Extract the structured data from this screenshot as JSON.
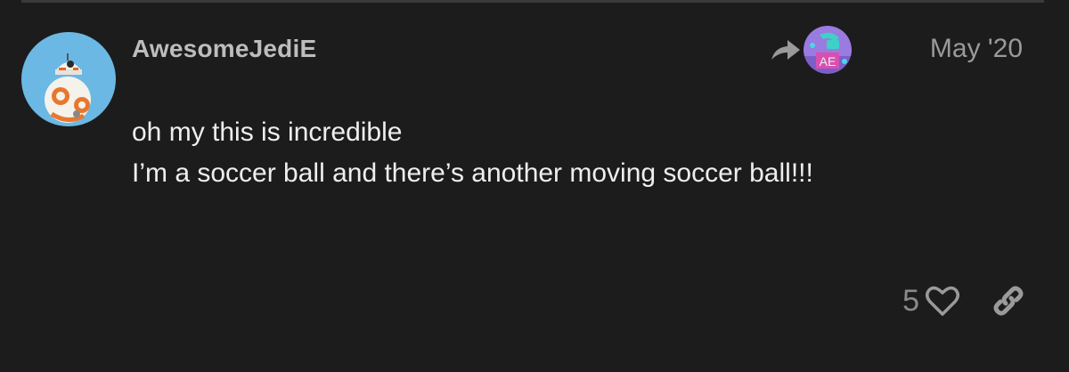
{
  "post": {
    "username": "AwesomeJediE",
    "date": "May '20",
    "lines": [
      "oh my this is incredible",
      "I’m a soccer ball and there’s another moving soccer ball!!!"
    ],
    "reply_to_avatar_text": "AE",
    "like_count": "5"
  },
  "colors": {
    "background": "#1c1c1c",
    "avatar_bg": "#6bb8e4",
    "username": "#bdbdbd",
    "meta": "#9a9a9a"
  },
  "icons": {
    "reply": "reply-arrow-icon",
    "like": "heart-outline-icon",
    "share": "link-icon"
  }
}
